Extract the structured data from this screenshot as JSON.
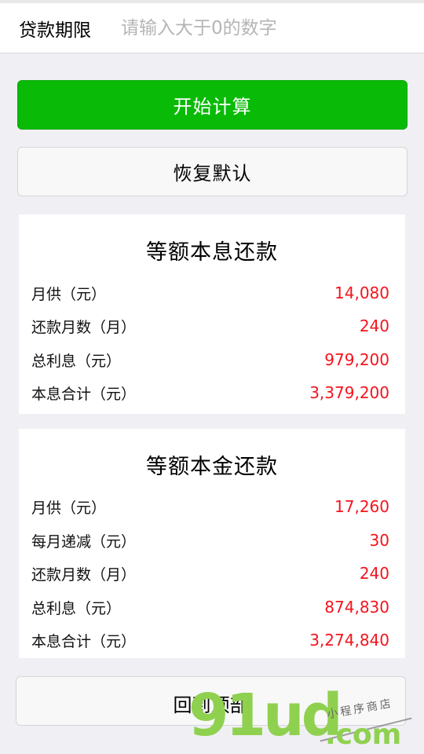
{
  "form": {
    "term_label": "贷款期限",
    "term_value": "",
    "term_placeholder": "请输入大于0的数字"
  },
  "actions": {
    "calculate_label": "开始计算",
    "reset_label": "恢复默认",
    "back_to_top_label": "回到顶部"
  },
  "equal_installment": {
    "title": "等额本息还款",
    "rows": [
      {
        "label": "月供（元）",
        "value": "14,080"
      },
      {
        "label": "还款月数（月）",
        "value": "240"
      },
      {
        "label": "总利息（元）",
        "value": "979,200"
      },
      {
        "label": "本息合计（元）",
        "value": "3,379,200"
      }
    ]
  },
  "equal_principal": {
    "title": "等额本金还款",
    "rows": [
      {
        "label": "月供（元）",
        "value": "17,260"
      },
      {
        "label": "每月递减（元）",
        "value": "30"
      },
      {
        "label": "还款月数（月）",
        "value": "240"
      },
      {
        "label": "总利息（元）",
        "value": "874,830"
      },
      {
        "label": "本息合计（元）",
        "value": "3,274,840"
      }
    ]
  },
  "watermark": {
    "brand": "91ud",
    "domain": ".com",
    "tagline": "小程序商店"
  },
  "colors": {
    "primary": "#09bb07",
    "value_red": "#f4141e",
    "watermark_green": "#8fd14f"
  }
}
